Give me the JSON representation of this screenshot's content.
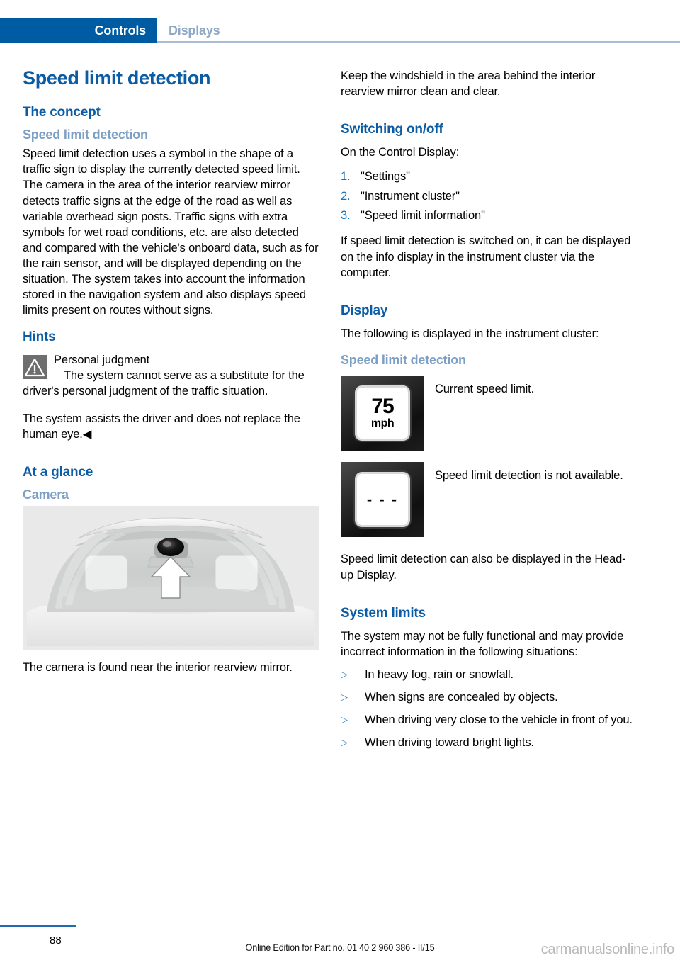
{
  "header": {
    "active_tab": "Controls",
    "inactive_tab": "Displays"
  },
  "left_column": {
    "title": "Speed limit detection",
    "concept_heading": "The concept",
    "concept_subheading": "Speed limit detection",
    "concept_paragraph": "Speed limit detection uses a symbol in the shape of a traffic sign to display the currently detected speed limit. The camera in the area of the interior rearview mirror detects traffic signs at the edge of the road as well as variable overhead sign posts. Traffic signs with extra symbols for wet road conditions, etc. are also detected and compared with the vehicle's onboard data, such as for the rain sensor, and will be displayed depending on the situation. The system takes into account the information stored in the navigation system and also displays speed limits present on routes without signs.",
    "hints_heading": "Hints",
    "hint_title": "Personal judgment",
    "hint_body": "The system cannot serve as a substitute for the driver's personal judgment of the traffic situation.",
    "hint_paragraph2": "The system assists the driver and does not replace the human eye.◀",
    "at_a_glance_heading": "At a glance",
    "camera_subheading": "Camera",
    "camera_caption": "The camera is found near the interior rearview mirror."
  },
  "right_column": {
    "windshield_note": "Keep the windshield in the area behind the interior rearview mirror clean and clear.",
    "switching_heading": "Switching on/off",
    "switching_intro": "On the Control Display:",
    "switching_steps": [
      {
        "num": "1.",
        "label": "\"Settings\""
      },
      {
        "num": "2.",
        "label": "\"Instrument cluster\""
      },
      {
        "num": "3.",
        "label": "\"Speed limit information\""
      }
    ],
    "switching_note": "If speed limit detection is switched on, it can be displayed on the info display in the instrument cluster via the computer.",
    "display_heading": "Display",
    "display_intro": "The following is displayed in the instrument cluster:",
    "display_subheading": "Speed limit detection",
    "display_items": [
      {
        "icon_value": "75",
        "icon_unit": "mph",
        "caption": "Current speed limit."
      },
      {
        "icon_value": "- - -",
        "caption": "Speed limit detection is not available."
      }
    ],
    "hud_note": "Speed limit detection can also be displayed in the Head-up Display.",
    "system_limits_heading": "System limits",
    "system_limits_intro": "The system may not be fully functional and may provide incorrect information in the following situations:",
    "system_limits_items": [
      "In heavy fog, rain or snowfall.",
      "When signs are concealed by objects.",
      "When driving very close to the vehicle in front of you.",
      "When driving toward bright lights."
    ],
    "bullet_glyph": "▷"
  },
  "footer": {
    "page_number": "88",
    "edition": "Online Edition for Part no. 01 40 2 960 386 - II/15",
    "watermark": "carmanualsonline.info"
  },
  "colors": {
    "tab_blue": "#005ca2",
    "heading_blue": "#0b5ca4",
    "subheading_blue": "#7d9fc4",
    "accent_blue": "#1272bd",
    "warn_gray": "#6e6e6e"
  }
}
